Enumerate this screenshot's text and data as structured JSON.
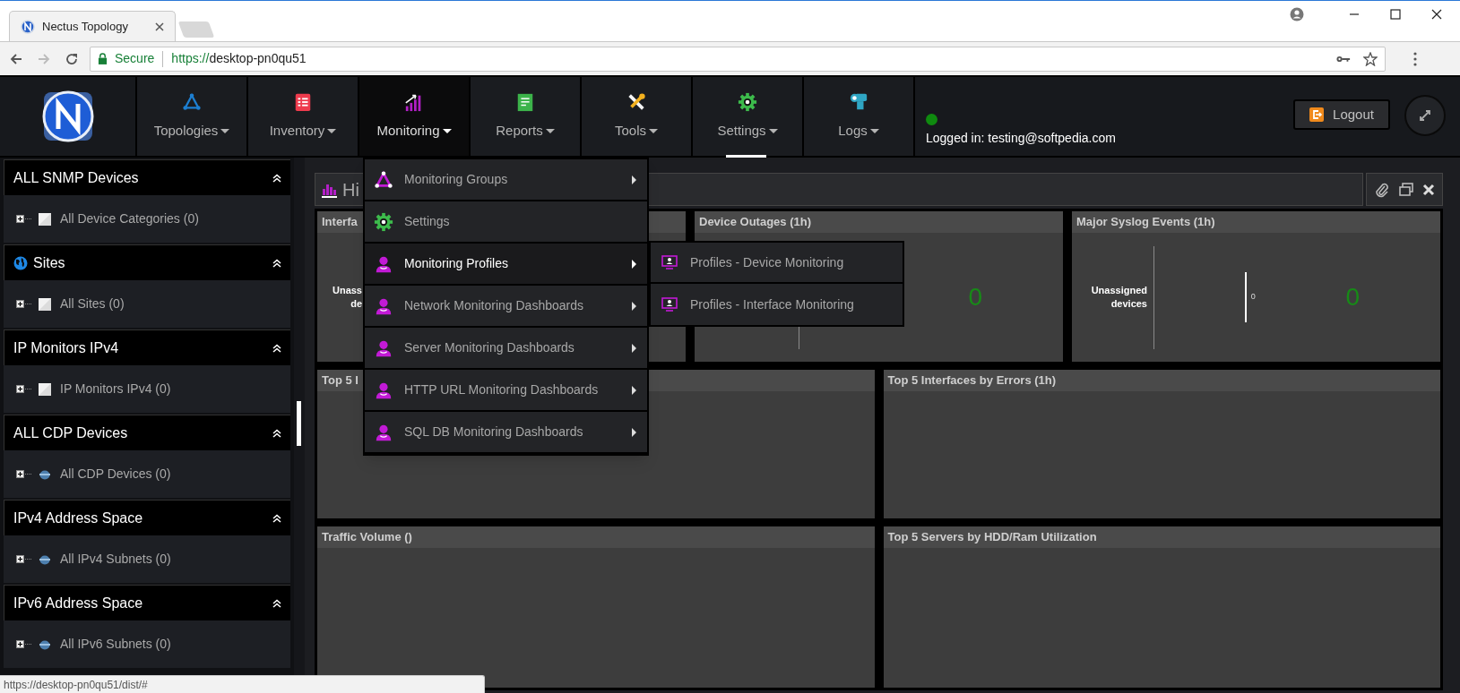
{
  "browser": {
    "tab_title": "Nectus Topology",
    "secure_label": "Secure",
    "url_scheme": "https://",
    "url_host": "desktop-pn0qu51",
    "status_url": "https://desktop-pn0qu51/dist/#"
  },
  "nav": [
    {
      "label": "Topologies",
      "kind": "triangle",
      "selected": false
    },
    {
      "label": "Inventory",
      "kind": "clipboard",
      "selected": false
    },
    {
      "label": "Monitoring",
      "kind": "signal",
      "selected": true
    },
    {
      "label": "Reports",
      "kind": "document",
      "selected": false
    },
    {
      "label": "Tools",
      "kind": "wrench",
      "selected": false
    },
    {
      "label": "Settings",
      "kind": "gear",
      "selected": false
    },
    {
      "label": "Logs",
      "kind": "camera",
      "selected": false
    }
  ],
  "user": {
    "online": true,
    "logged_in": "Logged in: testing@softpedia.com"
  },
  "logout": "Logout",
  "sidebar": [
    {
      "title": "ALL SNMP Devices",
      "kind": "plain",
      "expanded": true,
      "item": {
        "label": "All Device Categories (0)",
        "kind": "square"
      }
    },
    {
      "title": "Sites",
      "kind": "globe",
      "expanded": true,
      "item": {
        "label": "All Sites (0)",
        "kind": "square"
      }
    },
    {
      "title": "IP Monitors IPv4",
      "kind": "plain",
      "expanded": true,
      "item": {
        "label": "IP Monitors IPv4 (0)",
        "kind": "square"
      }
    },
    {
      "title": "ALL CDP Devices",
      "kind": "plain",
      "expanded": true,
      "item": {
        "label": "All CDP Devices (0)",
        "kind": "device"
      }
    },
    {
      "title": "IPv4 Address Space",
      "kind": "plain",
      "expanded": true,
      "item": {
        "label": "All IPv4 Subnets (0)",
        "kind": "device"
      }
    },
    {
      "title": "IPv6 Address Space",
      "kind": "plain",
      "expanded": true,
      "item": {
        "label": "All IPv6 Subnets (0)",
        "kind": "device"
      }
    }
  ],
  "dashboard": {
    "title": "Hi",
    "rows": [
      [
        {
          "title": "Interfa",
          "label_lines": [
            "Unass",
            "de"
          ]
        },
        {
          "title": "Device Outages (1h)",
          "count": "0"
        },
        {
          "title": "Major Syslog Events (1h)",
          "label_lines": [
            "Unassigned",
            "devices"
          ],
          "axis_value": "0",
          "count": "0"
        }
      ],
      [
        {
          "title": "Top 5 I"
        },
        {
          "title": "Top 5 Interfaces by Errors (1h)"
        }
      ],
      [
        {
          "title": "Traffic Volume ()"
        },
        {
          "title": "Top 5 Servers by HDD/Ram Utilization"
        }
      ]
    ]
  },
  "dropdown": [
    {
      "label": "Monitoring Groups",
      "kind": "triangle",
      "selected": false,
      "has_submenu": true
    },
    {
      "label": "Settings",
      "kind": "gear",
      "selected": false,
      "has_submenu": false
    },
    {
      "label": "Monitoring Profiles",
      "kind": "person",
      "selected": true,
      "has_submenu": true
    },
    {
      "label": "Network Monitoring Dashboards",
      "kind": "person",
      "selected": false,
      "has_submenu": true
    },
    {
      "label": "Server Monitoring Dashboards",
      "kind": "person",
      "selected": false,
      "has_submenu": true
    },
    {
      "label": "HTTP URL Monitoring Dashboards",
      "kind": "person",
      "selected": false,
      "has_submenu": true
    },
    {
      "label": "SQL DB Monitoring Dashboards",
      "kind": "person",
      "selected": false,
      "has_submenu": true
    }
  ],
  "submenu": [
    {
      "label": "Profiles - Device Monitoring"
    },
    {
      "label": "Profiles - Interface Monitoring"
    }
  ]
}
